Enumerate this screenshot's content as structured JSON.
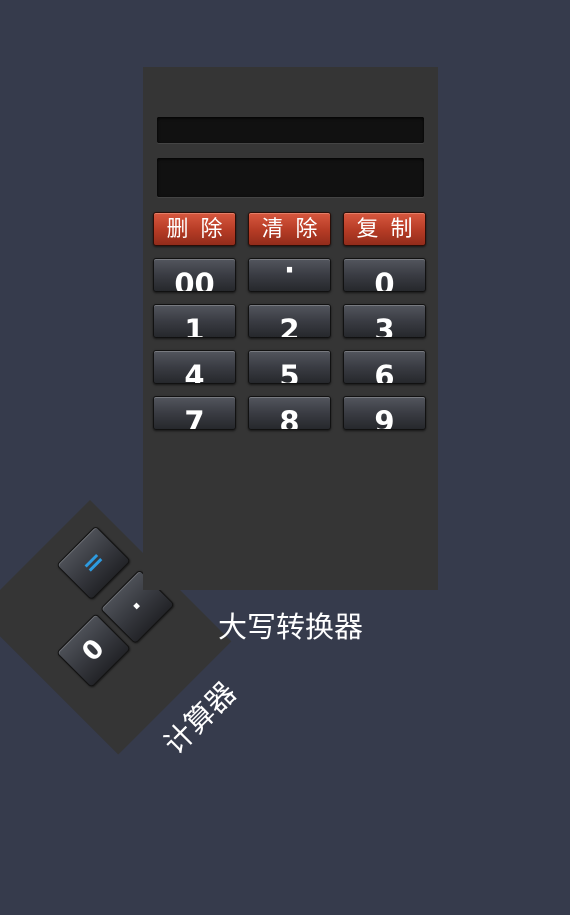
{
  "converter": {
    "title": "大写转换器",
    "display_top": "",
    "display_bottom": "",
    "function_buttons": [
      "删除",
      "清除",
      "复制"
    ],
    "number_rows": [
      [
        "00",
        "·",
        "0"
      ],
      [
        "1",
        "2",
        "3"
      ],
      [
        "4",
        "5",
        "6"
      ],
      [
        "7",
        "8",
        "9"
      ]
    ]
  },
  "side_widget": {
    "label": "计算器",
    "keys": [
      "=",
      "·",
      "0"
    ]
  }
}
